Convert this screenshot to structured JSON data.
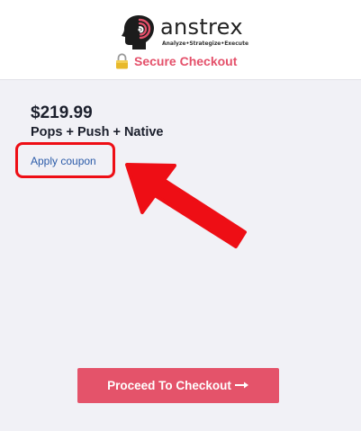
{
  "header": {
    "brand": {
      "name": "anstrex",
      "tagline": "Analyze•Strategize•Execute",
      "logo_color": "#e4506a"
    },
    "secure_checkout": {
      "icon": "lock-icon",
      "label": "Secure Checkout",
      "color": "#e4506a"
    }
  },
  "plan": {
    "price": "$219.99",
    "name": "Pops + Push + Native"
  },
  "coupon": {
    "link_label": "Apply coupon",
    "highlight_color": "#ee0e15"
  },
  "annotation": {
    "arrow_color": "#ee0e15"
  },
  "checkout": {
    "button_label": "Proceed To Checkout",
    "button_icon": "arrow-right-icon",
    "button_color": "#e4536a"
  }
}
